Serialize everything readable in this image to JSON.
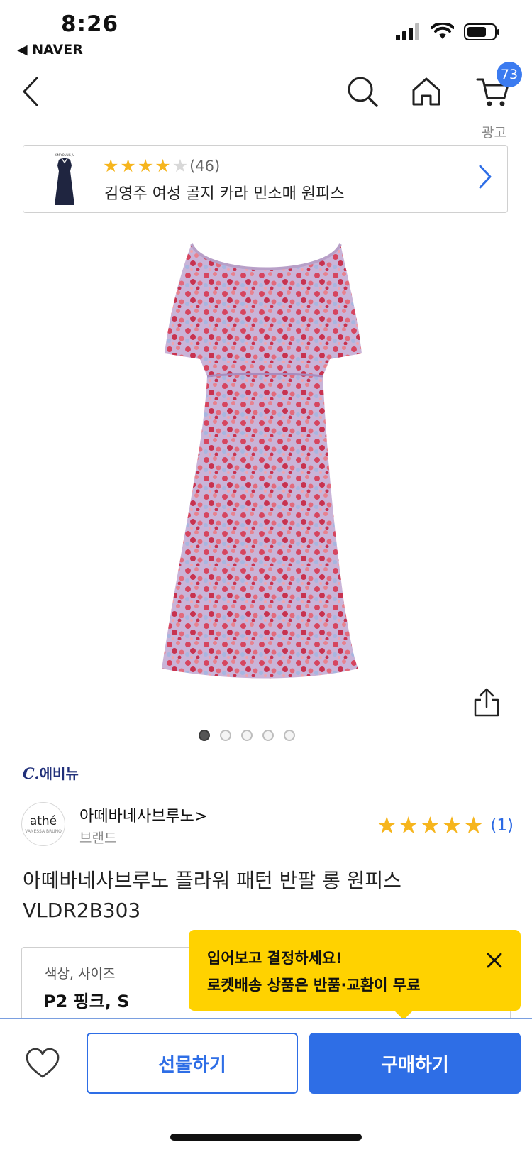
{
  "status_bar": {
    "time": "8:26",
    "back_app": "◀ NAVER",
    "icons": [
      "signal-icon",
      "wifi-icon",
      "battery-icon"
    ]
  },
  "nav": {
    "back_icon": "chevron-left-icon",
    "search_icon": "search-icon",
    "home_icon": "home-icon",
    "cart_icon": "cart-icon",
    "cart_count": "73"
  },
  "ad": {
    "label": "광고",
    "rating_count": "(46)",
    "rating_stars": 4,
    "title": "김영주 여성 골지 카라 민소매 원피스"
  },
  "gallery": {
    "total_images": 5,
    "current_index": 1
  },
  "seller": {
    "logo_mark": "C.",
    "logo_text": "에비뉴"
  },
  "brand": {
    "avatar_text": "athé",
    "avatar_subtext": "VANESSA BRUNO",
    "name": "아떼바네사브루노>",
    "sub": "브랜드",
    "rating_stars": 5,
    "review_count": "(1)"
  },
  "product": {
    "title_line1": "아떼바네사브루노 플라워 패턴 반팔 롱 원피스",
    "title_line2": "VLDR2B303"
  },
  "option": {
    "label": "색상, 사이즈",
    "value": "P2 핑크, S"
  },
  "tooltip": {
    "line1": "입어보고 결정하세요!",
    "line2": "로켓배송 상품은 반품·교환이 무료"
  },
  "actions": {
    "gift": "선물하기",
    "buy": "구매하기"
  },
  "colors": {
    "accent": "#2e6ee6",
    "badge": "#3b7bf0",
    "star": "#f6b51d",
    "tooltip": "#ffd200"
  }
}
